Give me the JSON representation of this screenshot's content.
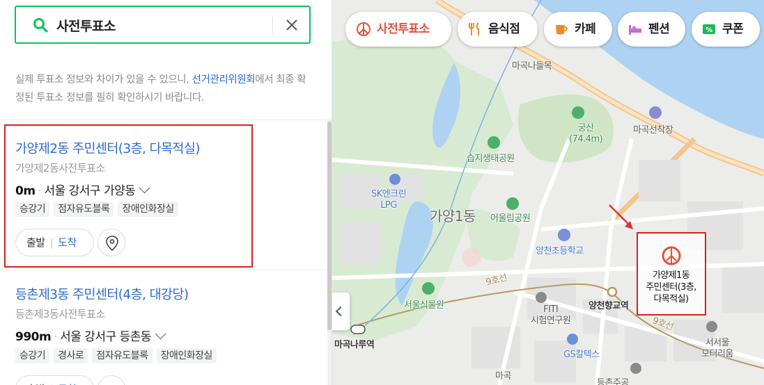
{
  "search": {
    "query": "사전투표소"
  },
  "notice": {
    "text_before": "실제 투표소 정보와 차이가 있을 수 있으니, ",
    "link": "선거관리위원회",
    "text_after": "에서 최종 확정된 투표소 정보를 필히 확인하시기 바랍니다."
  },
  "results": [
    {
      "title": "가양제2동 주민센터(3층, 다목적실)",
      "subtitle": "가양제2동사전투표소",
      "distance": "0m",
      "address": "서울 강서구 가양동",
      "tags": [
        "승강기",
        "점자유도블록",
        "장애인화장실"
      ],
      "route_start": "출발",
      "route_arrive": "도착"
    },
    {
      "title": "등촌제3동 주민센터(4층, 대강당)",
      "subtitle": "등촌제3동사전투표소",
      "distance": "990m",
      "address": "서울 강서구 등촌동",
      "tags": [
        "승강기",
        "경사로",
        "점자유도블록",
        "장애인화장실"
      ],
      "route_start": "출발",
      "route_arrive": "도착"
    }
  ],
  "map": {
    "chips": [
      {
        "label": "사전투표소",
        "icon": "ballot-icon",
        "color": "#e2533b"
      },
      {
        "label": "음식점",
        "icon": "fork-knife-icon",
        "color": "#f08a24"
      },
      {
        "label": "카페",
        "icon": "cup-icon",
        "color": "#f08a24"
      },
      {
        "label": "펜션",
        "icon": "bed-icon",
        "color": "#c96ad6"
      },
      {
        "label": "쿠폰",
        "icon": "coupon-icon",
        "color": "#1db954"
      }
    ],
    "labels": {
      "magok_deulmok": "마곡나들목",
      "gungsan": "궁산",
      "gungsan_height": "(74.4m)",
      "magok_port": "마곡선착장",
      "wetland_park": "습지생태공원",
      "sk_station": "SK엔크린",
      "lpg": "LPG",
      "gayang1dong": "가양1동",
      "eoullim_park": "어울림공원",
      "yangcheon_school": "양천초등학교",
      "botanic_garden": "서울식물원",
      "line9_a": "9호선",
      "line9_b": "9호선",
      "yangcheon_hyanggyo": "양천향교역",
      "fiti": "FITI",
      "fiti_sub": "시험연구원",
      "gs_caltex": "GS칼텍스",
      "magok_naru": "마곡나루역",
      "seoul_motel": "서서울",
      "seoul_motel_sub": "모터리움",
      "magok_bottom": "마곡",
      "deungchon": "등촌주공"
    },
    "target_marker": {
      "name": "가양제1동",
      "line2": "주민센터(3층,",
      "line3": "다목적실)"
    }
  },
  "colors": {
    "brand_green": "#03c75a",
    "link_blue": "#2d6bd6",
    "highlight_red": "#d62020",
    "water": "#aed3f2",
    "park": "#d8ead1"
  }
}
